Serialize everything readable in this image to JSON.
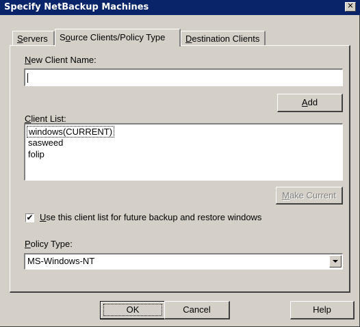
{
  "window": {
    "title": "Specify NetBackup Machines",
    "close_symbol": "✕"
  },
  "tabs": [
    {
      "label": "Servers",
      "mnemonic": "S",
      "rest": "ervers",
      "active": false
    },
    {
      "label": "Source Clients/Policy Type",
      "mnemonic_pre": "S",
      "mnemonic": "o",
      "rest": "urce Clients/Policy Type",
      "active": true
    },
    {
      "label": "Destination Clients",
      "mnemonic": "D",
      "rest": "estination Clients",
      "active": false
    }
  ],
  "new_client": {
    "label_mnemonic": "N",
    "label_rest": "ew Client Name:",
    "value": ""
  },
  "add_button": {
    "mnemonic": "A",
    "rest": "dd"
  },
  "client_list": {
    "label_mnemonic": "C",
    "label_rest": "lient List:",
    "items": [
      "windows(CURRENT)",
      "sasweed",
      "folip"
    ],
    "selected_index": 0
  },
  "make_current_button": {
    "mnemonic": "M",
    "rest": "ake Current",
    "enabled": false
  },
  "use_list_checkbox": {
    "checked": true,
    "check_mark": "✔",
    "label_mnemonic": "U",
    "label_rest": "se this client list for future backup and restore windows"
  },
  "policy_type": {
    "label_mnemonic": "P",
    "label_rest": "olicy Type:",
    "selected": "MS-Windows-NT"
  },
  "footer": {
    "ok_label": "OK",
    "cancel_label": "Cancel",
    "help_label": "Help"
  }
}
